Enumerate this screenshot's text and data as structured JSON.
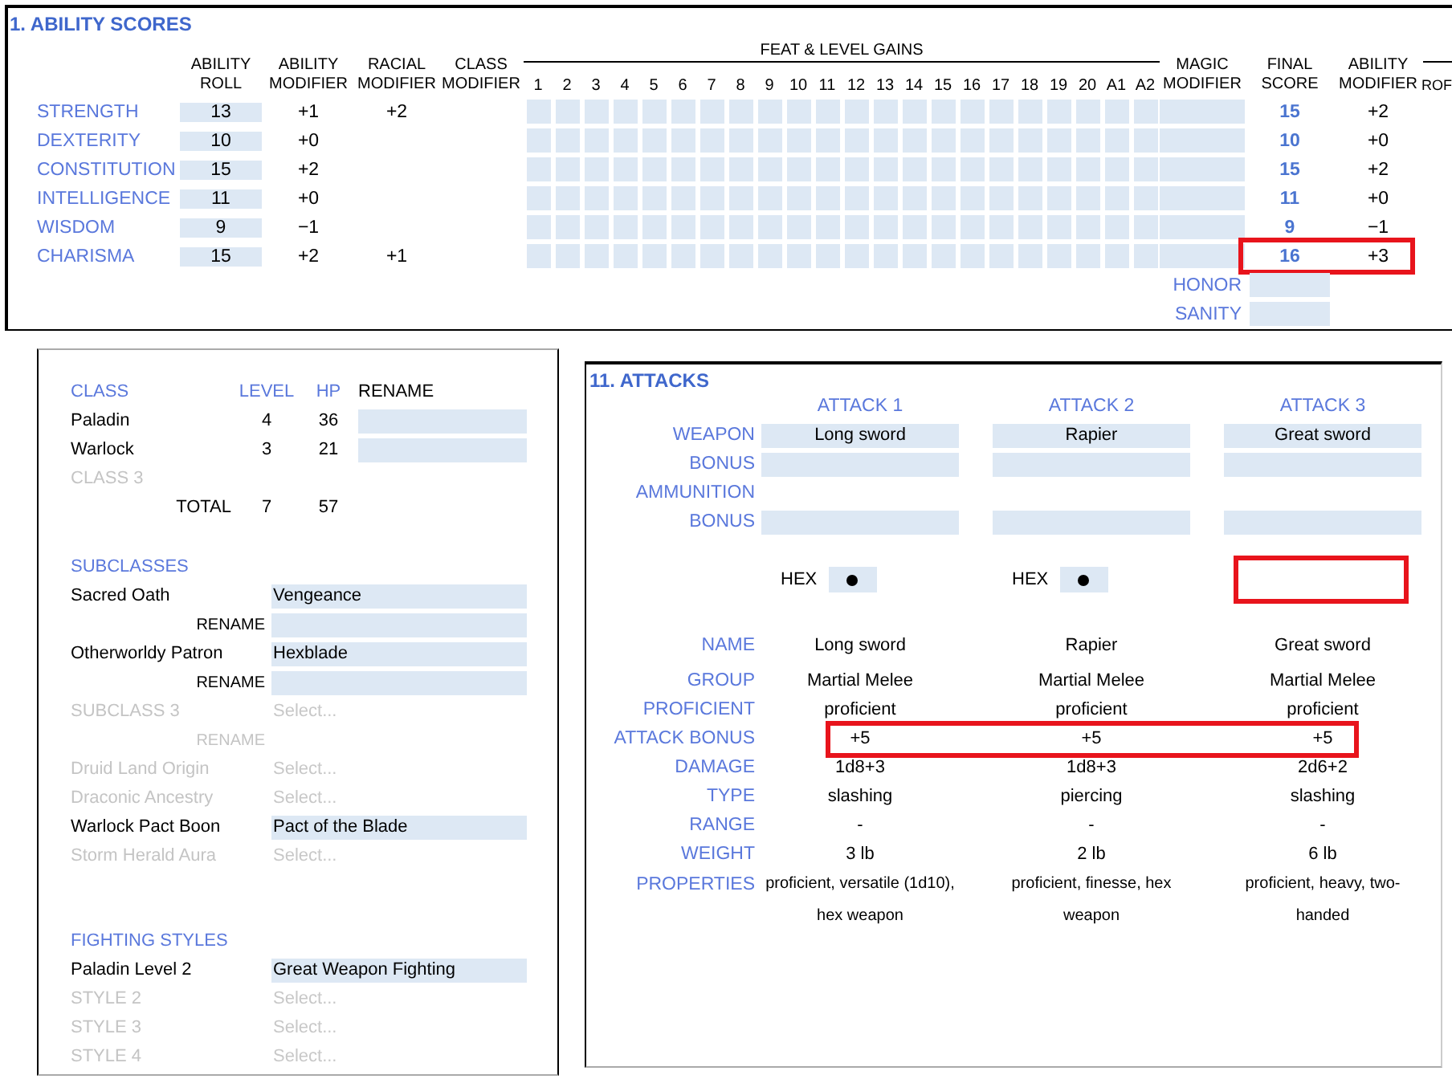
{
  "ability_scores": {
    "title": "1. ABILITY SCORES",
    "columns": {
      "roll": "ABILITY ROLL",
      "modifier": "ABILITY MODIFIER",
      "racial": "RACIAL MODIFIER",
      "class": "CLASS MODIFIER",
      "feat_group": "FEAT & LEVEL GAINS",
      "magic": "MAGIC MODIFIER",
      "final": "FINAL SCORE",
      "final_modifier": "ABILITY MODIFIER",
      "column_cut": "ROF"
    },
    "feat_columns": [
      "1",
      "2",
      "3",
      "4",
      "5",
      "6",
      "7",
      "8",
      "9",
      "10",
      "11",
      "12",
      "13",
      "14",
      "15",
      "16",
      "17",
      "18",
      "19",
      "20",
      "A1",
      "A2"
    ],
    "rows": [
      {
        "name": "STRENGTH",
        "roll": "13",
        "modifier": "+1",
        "racial": "+2",
        "final": "15",
        "final_modifier": "+2",
        "highlighted": false
      },
      {
        "name": "DEXTERITY",
        "roll": "10",
        "modifier": "+0",
        "final": "10",
        "final_modifier": "+0",
        "highlighted": false
      },
      {
        "name": "CONSTITUTION",
        "roll": "15",
        "modifier": "+2",
        "final": "15",
        "final_modifier": "+2",
        "highlighted": false
      },
      {
        "name": "INTELLIGENCE",
        "roll": "11",
        "modifier": "+0",
        "final": "11",
        "final_modifier": "+0",
        "highlighted": false
      },
      {
        "name": "WISDOM",
        "roll": "9",
        "modifier": "−1",
        "final": "9",
        "final_modifier": "−1",
        "highlighted": false
      },
      {
        "name": "CHARISMA",
        "roll": "15",
        "modifier": "+2",
        "racial": "+1",
        "final": "16",
        "final_modifier": "+3",
        "highlighted": true
      }
    ],
    "extra_rows": [
      {
        "name": "HONOR"
      },
      {
        "name": "SANITY"
      }
    ]
  },
  "classes_panel": {
    "header": {
      "class": "CLASS",
      "level": "LEVEL",
      "hp": "HP",
      "rename": "RENAME"
    },
    "classes": [
      {
        "name": "Paladin",
        "level": "4",
        "hp": "36",
        "disabled": false
      },
      {
        "name": "Warlock",
        "level": "3",
        "hp": "21",
        "disabled": false
      },
      {
        "name": "CLASS 3",
        "disabled": true
      }
    ],
    "total": {
      "label": "TOTAL",
      "level": "7",
      "hp": "57"
    },
    "sections": [
      {
        "title": "SUBCLASSES",
        "rows": [
          {
            "kind": "select",
            "label": "Sacred Oath",
            "value": "Vengeance",
            "disabled": false
          },
          {
            "kind": "rename",
            "label": "RENAME",
            "disabled": false
          },
          {
            "kind": "select",
            "label": "Otherworldy Patron",
            "value": "Hexblade",
            "disabled": false
          },
          {
            "kind": "rename",
            "label": "RENAME",
            "disabled": false
          },
          {
            "kind": "select",
            "label": "SUBCLASS 3",
            "placeholder": "Select...",
            "disabled": true
          },
          {
            "kind": "rename",
            "label": "RENAME",
            "disabled": true
          },
          {
            "kind": "select",
            "label": "Druid Land Origin",
            "placeholder": "Select...",
            "disabled": true
          },
          {
            "kind": "select",
            "label": "Draconic Ancestry",
            "placeholder": "Select...",
            "disabled": true
          },
          {
            "kind": "select",
            "label": "Warlock Pact Boon",
            "value": "Pact of the Blade",
            "disabled": false
          },
          {
            "kind": "select",
            "label": "Storm Herald Aura",
            "placeholder": "Select...",
            "disabled": true
          }
        ]
      },
      {
        "title": "FIGHTING STYLES",
        "rows": [
          {
            "kind": "select",
            "label": "Paladin Level 2",
            "value": "Great Weapon Fighting",
            "disabled": false
          },
          {
            "kind": "select",
            "label": "STYLE 2",
            "placeholder": "Select...",
            "disabled": true
          },
          {
            "kind": "select",
            "label": "STYLE 3",
            "placeholder": "Select...",
            "disabled": true
          },
          {
            "kind": "select",
            "label": "STYLE 4",
            "placeholder": "Select...",
            "disabled": true
          }
        ]
      }
    ]
  },
  "attacks": {
    "title": "11. ATTACKS",
    "headers": [
      "ATTACK 1",
      "ATTACK 2",
      "ATTACK 3"
    ],
    "inputs": [
      {
        "kind": "field",
        "label": "WEAPON",
        "values": [
          "Long sword",
          "Rapier",
          "Great sword"
        ]
      },
      {
        "kind": "field",
        "label": "BONUS"
      },
      {
        "kind": "label",
        "label": "AMMUNITION"
      },
      {
        "kind": "field",
        "label": "BONUS"
      }
    ],
    "hex": [
      {
        "label": "HEX",
        "checked": true,
        "highlighted": false
      },
      {
        "label": "HEX",
        "checked": true,
        "highlighted": false
      },
      {
        "highlighted": true
      }
    ],
    "details": [
      {
        "label": "NAME",
        "values": [
          "Long sword",
          "Rapier",
          "Great sword"
        ],
        "highlighted": false
      },
      {
        "label": "GROUP",
        "values": [
          "Martial Melee",
          "Martial Melee",
          "Martial Melee"
        ],
        "highlighted": false
      },
      {
        "label": "PROFICIENT",
        "values": [
          "proficient",
          "proficient",
          "proficient"
        ],
        "highlighted": false
      },
      {
        "label": "ATTACK BONUS",
        "values": [
          "+5",
          "+5",
          "+5"
        ],
        "highlighted": true
      },
      {
        "label": "DAMAGE",
        "values": [
          "1d8+3",
          "1d8+3",
          "2d6+2"
        ],
        "highlighted": false
      },
      {
        "label": "TYPE",
        "values": [
          "slashing",
          "piercing",
          "slashing"
        ],
        "highlighted": false
      },
      {
        "label": "RANGE",
        "values": [
          "-",
          "-",
          "-"
        ],
        "highlighted": false
      },
      {
        "label": "WEIGHT",
        "values": [
          "3 lb",
          "2 lb",
          "6 lb"
        ],
        "highlighted": false
      },
      {
        "label": "PROPERTIES",
        "values": [
          "proficient, versatile (1d10), hex weapon",
          "proficient, finesse, hex weapon",
          "proficient, heavy, two-handed"
        ],
        "highlighted": false
      }
    ]
  }
}
